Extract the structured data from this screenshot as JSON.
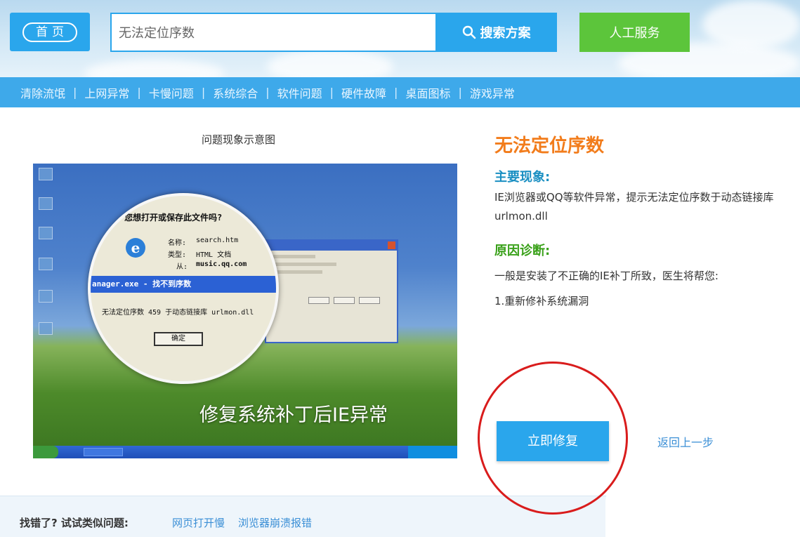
{
  "header": {
    "home_label": "首页",
    "search": {
      "value": "无法定位序数"
    },
    "search_button": "搜索方案",
    "human_service": "人工服务"
  },
  "nav": {
    "items": [
      "清除流氓",
      "上网异常",
      "卡慢问题",
      "系统综合",
      "软件问题",
      "硬件故障",
      "桌面图标",
      "游戏异常"
    ],
    "separator": "|"
  },
  "illustration": {
    "caption": "问题现象示意图",
    "dialog_title": "您想打开或保存此文件吗?",
    "file_name_label": "名称:",
    "file_name": "search.htm",
    "file_type_label": "类型:",
    "file_type": "HTML 文档",
    "from_label": "从:",
    "from_value": "music.qq.com",
    "error_title": "anager.exe - 找不到序数",
    "error_message": "无法定位序数 459 于动态链接库 urlmon.dll",
    "ok_button": "确定",
    "overlay_text": "修复系统补丁后IE异常"
  },
  "issue": {
    "title": "无法定位序数",
    "symptom_heading": "主要现象:",
    "symptom_text": "IE浏览器或QQ等软件异常，提示无法定位序数于动态链接库urlmon.dll",
    "diagnosis_heading": "原因诊断:",
    "diagnosis_text": "一般是安装了不正确的IE补丁所致，医生将帮您:",
    "step_1": "1.重新修补系统漏洞"
  },
  "actions": {
    "repair_button": "立即修复",
    "back_link": "返回上一步"
  },
  "footer": {
    "label": "找错了? 试试类似问题:",
    "links": [
      "网页打开慢",
      "浏览器崩溃报错"
    ]
  },
  "colors": {
    "primary_blue": "#2aa6ec",
    "green": "#5cc53b",
    "orange_title": "#f27c1b",
    "teal_heading": "#1a8fc2",
    "green_heading": "#3aa11a",
    "highlight_circle": "#d91c1c"
  }
}
